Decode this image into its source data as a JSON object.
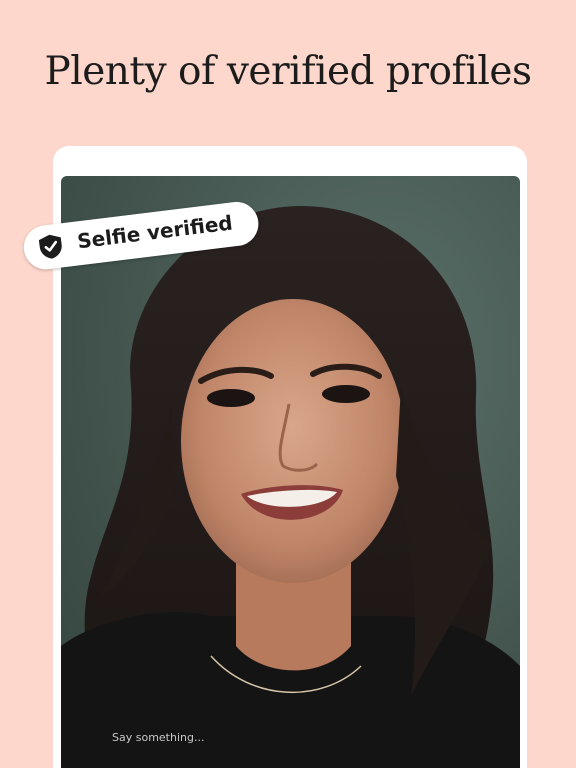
{
  "headline": "Plenty of verified profiles",
  "badge": {
    "label": "Selfie verified",
    "icon": "shield-check-icon"
  },
  "profile": {
    "photo": "portrait-photo"
  },
  "composer": {
    "placeholder": "Say something..."
  },
  "colors": {
    "background": "#fdd7cc",
    "card": "#ffffff",
    "text": "#1c1c1c"
  }
}
